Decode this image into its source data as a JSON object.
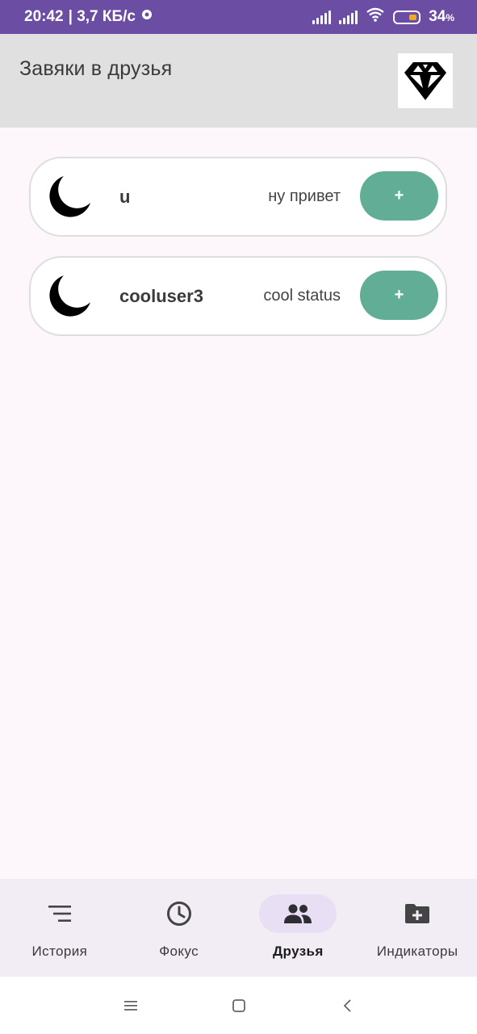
{
  "status_bar": {
    "time": "20:42",
    "speed": "| 3,7 КБ/с",
    "battery_percent": "34",
    "battery_unit": "%"
  },
  "app_bar": {
    "title": "Завяки в друзья",
    "logo_icon": "diamond-icon"
  },
  "requests": [
    {
      "username": "u",
      "status": "ну привет",
      "button_label": "+"
    },
    {
      "username": "cooluser3",
      "status": "cool status",
      "button_label": "+"
    }
  ],
  "bottom_nav": {
    "items": [
      {
        "label": "История",
        "icon": "history-list-icon",
        "active": false
      },
      {
        "label": "Фокус",
        "icon": "clock-icon",
        "active": false
      },
      {
        "label": "Друзья",
        "icon": "people-icon",
        "active": true
      },
      {
        "label": "Индикаторы",
        "icon": "folder-add-icon",
        "active": false
      }
    ]
  },
  "colors": {
    "status_bar": "#6b4ea3",
    "app_bar": "#e0e0e0",
    "accent_button": "#62ad95",
    "nav_active_pill": "#e8dff5",
    "background": "#fdf7fc"
  }
}
